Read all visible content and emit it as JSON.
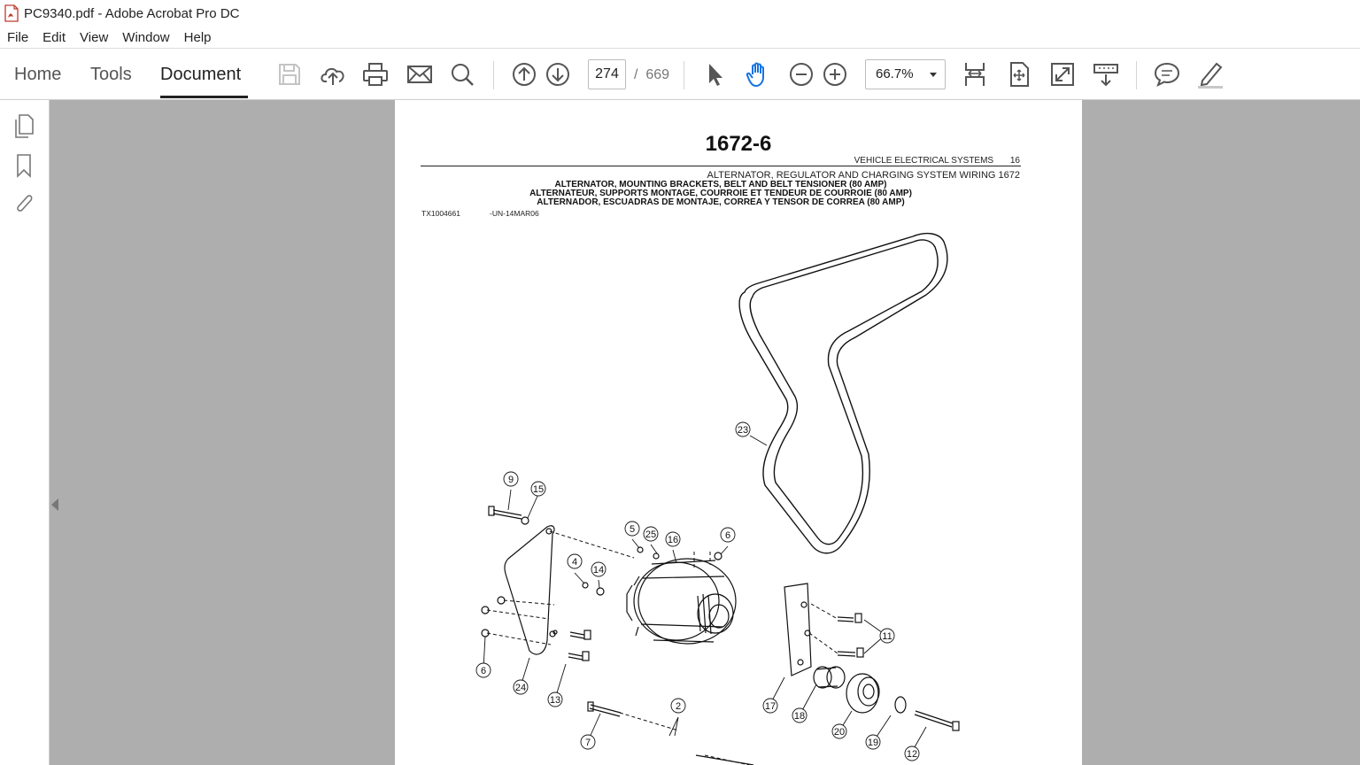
{
  "window": {
    "title": "PC9340.pdf - Adobe Acrobat Pro DC"
  },
  "menu": [
    "File",
    "Edit",
    "View",
    "Window",
    "Help"
  ],
  "nav_tabs": [
    {
      "label": "Home",
      "active": false
    },
    {
      "label": "Tools",
      "active": false
    },
    {
      "label": "Document",
      "active": true
    }
  ],
  "toolbar": {
    "page_current": "274",
    "page_separator": "/",
    "page_total": "669",
    "zoom": "66.7%",
    "icons": [
      "save-icon",
      "upload-cloud-icon",
      "print-icon",
      "email-icon",
      "search-icon",
      "previous-page-icon",
      "next-page-icon",
      "select-cursor-icon",
      "hand-tool-icon",
      "zoom-out-icon",
      "zoom-in-icon",
      "scroll-mode-icon",
      "fit-page-icon",
      "full-screen-icon",
      "read-mode-icon",
      "comment-icon",
      "highlight-pen-icon"
    ]
  },
  "left_panel": [
    "page-thumbnails-icon",
    "bookmarks-icon",
    "attachments-icon"
  ],
  "document": {
    "page_title": "1672-6",
    "header_section": "VEHICLE ELECTRICAL SYSTEMS",
    "header_section_number": "16",
    "subheader": "ALTERNATOR, REGULATOR AND CHARGING SYSTEM WIRING 1672",
    "captions": [
      "ALTERNATOR, MOUNTING BRACKETS, BELT AND BELT TENSIONER (80 AMP)",
      "ALTERNATEUR, SUPPORTS MONTAGE, COURROIE ET TENDEUR DE COURROIE (80 AMP)",
      "ALTERNADOR, ESCUADRAS DE MONTAJE, CORREA Y TENSOR DE CORREA (80 AMP)"
    ],
    "figure_id": "TX1004661",
    "figure_date": "-UN-14MAR06",
    "callouts": [
      "23",
      "9",
      "15",
      "5",
      "25",
      "16",
      "6",
      "4",
      "14",
      "6",
      "6",
      "24",
      "13",
      "11",
      "17",
      "18",
      "20",
      "19",
      "12",
      "2",
      "7"
    ]
  }
}
